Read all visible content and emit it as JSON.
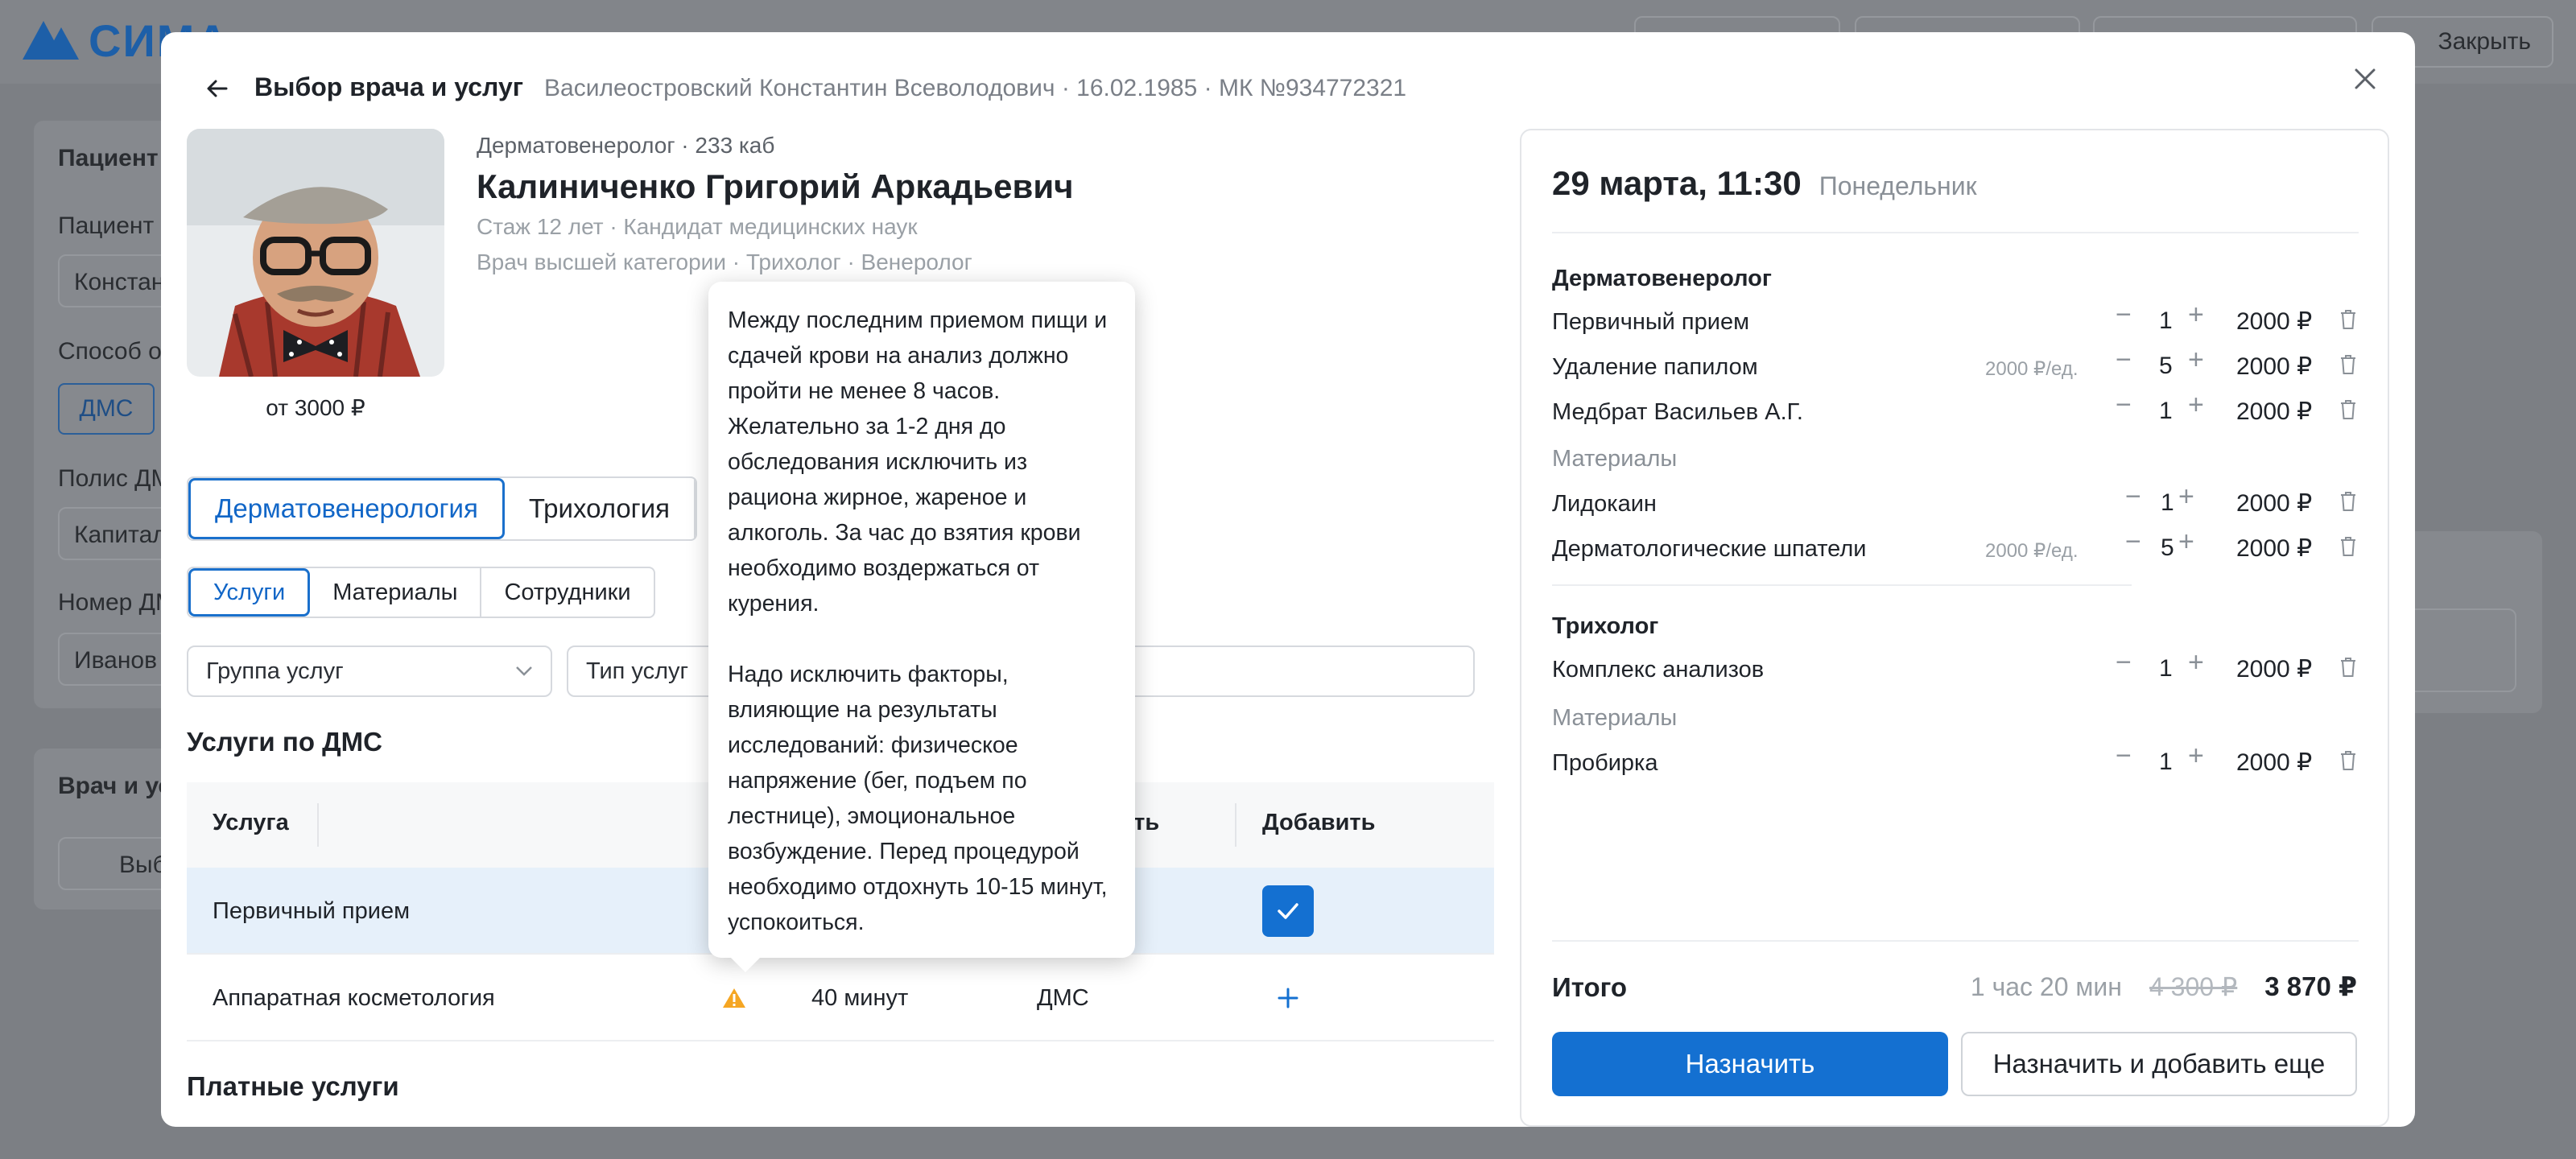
{
  "app": {
    "logo_text": "СИМА",
    "topbar_buttons": [
      "",
      "",
      ""
    ],
    "close_label": "Закрыть"
  },
  "background": {
    "patient_section": "Пациент",
    "patient_label": "Пациент",
    "patient_value": "Констан",
    "payment_label": "Способ о",
    "payment_value": "ДМС",
    "policy_label": "Полис ДМ",
    "policy_value": "Капитал",
    "policy_number_label": "Номер ДМ",
    "policy_number_value": "Иванов",
    "doctor_section": "Врач и ус",
    "select_doctor": "Выб"
  },
  "modal": {
    "title": "Выбор врача и услуг",
    "patient_info": "Василеостровский Константин Всеволодович · 16.02.1985 · МК №934772321"
  },
  "doctor": {
    "specialty": "Дерматовенеролог",
    "room": "233 каб",
    "name": "Калиниченко Григорий Аркадьевич",
    "experience": "Стаж 12 лет · Кандидат медицинских наук",
    "categories": "Врач высшей категории · Трихолог · Венеролог",
    "price_from": "от 3000 ₽"
  },
  "tabs": {
    "specialties": [
      "Дерматовенерология",
      "Трихология"
    ],
    "sections": [
      "Услуги",
      "Материалы",
      "Сотрудники"
    ]
  },
  "filters": {
    "group": "Группа услуг",
    "type": "Тип услуг"
  },
  "services": {
    "dms_title": "Услуги по ДМС",
    "paid_title": "Платные услуги",
    "headers": {
      "service": "Услуга",
      "payment": "сть",
      "add": "Добавить"
    },
    "rows": [
      {
        "name": "Первичный прием",
        "duration": "",
        "payment": "",
        "selected": true
      },
      {
        "name": "Аппаратная косметология",
        "duration": "40 минут",
        "payment": "ДМС",
        "selected": false
      }
    ]
  },
  "tooltip": {
    "p1": "Между последним приемом пищи и сдачей крови на анализ должно пройти не менее 8 часов. Желательно за 1-2 дня до обследования исключить из рациона жирное, жареное и алкоголь. За час до взятия крови необходимо воздержаться от курения.",
    "p2": "Надо исключить факторы, влияющие на результаты исследований: физическое напряжение (бег, подъем по лестнице), эмоциональное возбуждение. Перед процедурой необходимо отдохнуть 10-15 минут, успокоиться."
  },
  "order": {
    "date": "29 марта, 11:30",
    "weekday": "Понедельник",
    "groups": [
      {
        "title": "Дерматовенеролог",
        "items": [
          {
            "name": "Первичный прием",
            "unit": "",
            "qty": "1",
            "price": "2000 ₽"
          },
          {
            "name": "Удаление папилом",
            "unit": "2000 ₽/ед.",
            "qty": "5",
            "price": "2000 ₽"
          },
          {
            "name": "Медбрат Васильев А.Г.",
            "unit": "",
            "qty": "1",
            "price": "2000 ₽"
          }
        ],
        "materials_label": "Материалы",
        "materials": [
          {
            "name": "Лидокаин",
            "unit": "",
            "qty": "1",
            "price": "2000 ₽"
          },
          {
            "name": "Дерматологические шпатели",
            "unit": "2000 ₽/ед.",
            "qty": "5",
            "price": "2000 ₽"
          }
        ]
      },
      {
        "title": "Трихолог",
        "items": [
          {
            "name": "Комплекс анализов",
            "unit": "",
            "qty": "1",
            "price": "2000 ₽"
          }
        ],
        "materials_label": "Материалы",
        "materials": [
          {
            "name": "Пробирка",
            "unit": "",
            "qty": "1",
            "price": "2000 ₽"
          }
        ]
      }
    ],
    "total_label": "Итого",
    "duration": "1 час 20 мин",
    "old_price": "4 300 ₽",
    "total_price": "3 870 ₽",
    "assign_label": "Назначить",
    "assign_more_label": "Назначить и добавить еще"
  },
  "colors": {
    "accent": "#1470d1",
    "warning": "#f5a623",
    "selected_row": "#e6f0fa"
  }
}
